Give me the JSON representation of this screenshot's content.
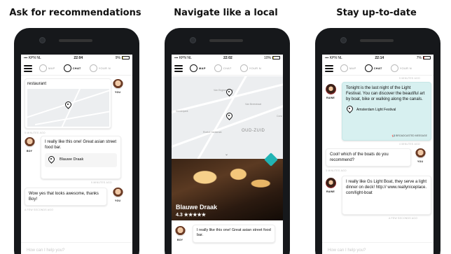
{
  "panels": [
    {
      "caption": "Ask for recommendations",
      "status": {
        "carrier": "KPN NL",
        "time": "22:04",
        "battery": "9%",
        "battery_level": 0.09
      },
      "nav": [
        {
          "label": "MAP"
        },
        {
          "label": "CHAT"
        },
        {
          "label": "YOUR N"
        }
      ],
      "messages": {
        "user1": "restaurant",
        "you_label": "YOU",
        "time1": "5 MINUTES AGO",
        "boy_label": "BOY",
        "boy_text": "I really like this one! Great asian street food bar.",
        "place": "Blauwe Draak",
        "time2": "5 MINUTES AGO",
        "user2": "Wow yes that looks awesome, thanks Boy!",
        "time3": "A FEW SECONDS AGO"
      },
      "input_placeholder": "How can I help you?"
    },
    {
      "caption": "Navigate like a local",
      "status": {
        "carrier": "KPN NL",
        "time": "22:02",
        "battery": "10%",
        "battery_level": 0.1
      },
      "nav": [
        {
          "label": "MAP"
        },
        {
          "label": "CHAT"
        },
        {
          "label": "YOUR N"
        }
      ],
      "map_labels": [
        "Van Eeghenstraat",
        "Van Breestraat",
        "Vondelpark",
        "Roelof Hartstraat",
        "OUD-ZUID",
        "Conc"
      ],
      "place_title": "Blauwe Draak",
      "rating": "4.3 ★★★★★",
      "boy_label": "BOY",
      "boy_text": "I really like this one! Great asian street food bar."
    },
    {
      "caption": "Stay up-to-date",
      "status": {
        "carrier": "KPN NL",
        "time": "22:14",
        "battery": "7%",
        "battery_level": 0.07
      },
      "nav": [
        {
          "label": "MAP"
        },
        {
          "label": "CHAT"
        },
        {
          "label": "YOUR N"
        }
      ],
      "messages": {
        "time0": "5 MINUTES AGO",
        "raine_label": "RAINE",
        "raine_text1": "Tonight is the last night of the Light Festival. You can discover the beautiful art by boat, bike or walking along the canals.",
        "event": "Amsterdam Light Festival",
        "broadcast": "BROADCASTED MESSAGE",
        "time1": "4 MINUTES AGO",
        "user_text": "Cool! which of the boats do you recommend?",
        "you_label": "YOU",
        "time2": "3 MINUTES AGO",
        "raine_text2": "I really like Gs Light Boat, they serve a light dinner on deck! http:// www.reallyniceplace.com/light-boat",
        "time3": "A FEW SECONDS AGO"
      },
      "input_placeholder": "How can I help you?"
    }
  ],
  "colors": {
    "accent_teal": "#21b4b4",
    "bubble_teal": "#d7f0f0",
    "battery_yellow": "#f2d64a"
  }
}
